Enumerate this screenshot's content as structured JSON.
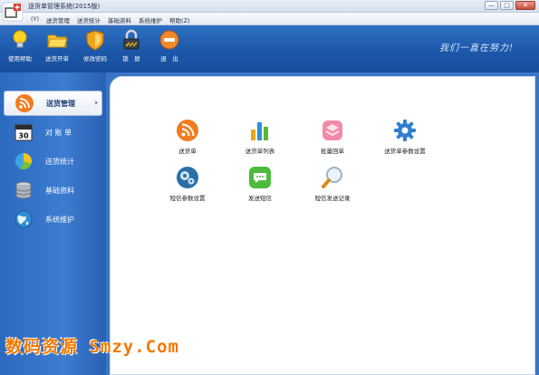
{
  "window": {
    "title": "送货单管理系统(2015版)",
    "controls": [
      "—",
      "□",
      "✕"
    ]
  },
  "menubar": {
    "items": [
      "(Y)",
      "送货管理",
      "送货统计",
      "基础资料",
      "系统维护",
      "帮助(Z)"
    ]
  },
  "toolbar": {
    "items": [
      {
        "label": "使用帮助",
        "icon": "lightbulb-icon"
      },
      {
        "label": "送货开单",
        "icon": "folder-icon"
      },
      {
        "label": "修改密码",
        "icon": "shield-icon"
      },
      {
        "label": "锁　屏",
        "icon": "lock-icon"
      },
      {
        "label": "退　出",
        "icon": "exit-icon"
      }
    ],
    "slogan": "我们一直在努力!"
  },
  "sidebar": {
    "items": [
      {
        "label": "送货管理",
        "icon": "rss-icon",
        "active": true
      },
      {
        "label": "对 账 单",
        "icon": "calendar-icon",
        "active": false
      },
      {
        "label": "送货统计",
        "icon": "pie-chart-icon",
        "active": false
      },
      {
        "label": "基础资料",
        "icon": "database-icon",
        "active": false
      },
      {
        "label": "系统维护",
        "icon": "globe-icon",
        "active": false
      }
    ],
    "calendar_number": "30"
  },
  "main": {
    "tiles": [
      {
        "label": "送货单",
        "icon": "rss-icon"
      },
      {
        "label": "送货单列表",
        "icon": "bar-chart-icon"
      },
      {
        "label": "批量回单",
        "icon": "layers-icon"
      },
      {
        "label": "送货单参数设置",
        "icon": "gear-icon"
      },
      {
        "label": "短信参数设置",
        "icon": "gears-icon"
      },
      {
        "label": "发送短信",
        "icon": "chat-icon"
      },
      {
        "label": "短信发送记录",
        "icon": "magnifier-icon"
      }
    ]
  },
  "watermark": "数码资源 Smzy.Com",
  "colors": {
    "toolbar_blue": "#1b56a8",
    "sidebar_blue": "#3c7cd0",
    "watermark_orange": "#f07a00"
  }
}
